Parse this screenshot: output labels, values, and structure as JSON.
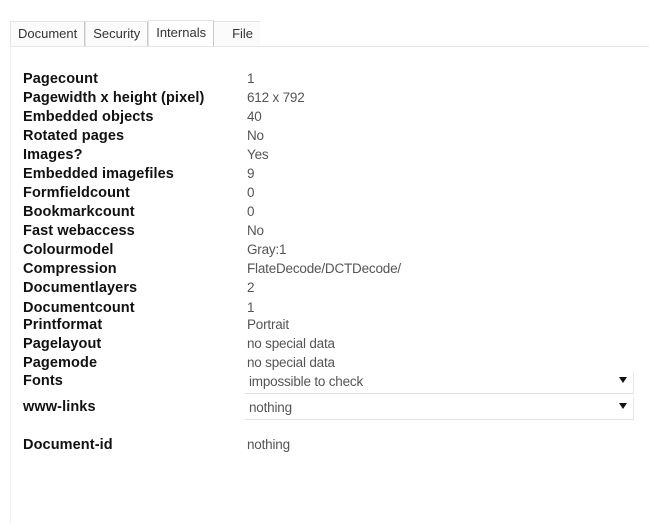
{
  "tabs": [
    {
      "label": "Document"
    },
    {
      "label": "Security"
    },
    {
      "label": "Internals"
    },
    {
      "label": "File"
    }
  ],
  "properties": [
    {
      "label": "Pagecount",
      "value": "1"
    },
    {
      "label": "Pagewidth x height (pixel)",
      "value": "612 x 792"
    },
    {
      "label": "Embedded objects",
      "value": "40"
    },
    {
      "label": "Rotated pages",
      "value": "No"
    },
    {
      "label": "Images?",
      "value": "Yes"
    },
    {
      "label": "Embedded imagefiles",
      "value": "9"
    },
    {
      "label": "Formfieldcount",
      "value": "0"
    },
    {
      "label": "Bookmarkcount",
      "value": "0"
    },
    {
      "label": "Fast webaccess",
      "value": "No"
    },
    {
      "label": "Colourmodel",
      "value": "Gray:1"
    },
    {
      "label": "Compression",
      "value": "FlateDecode/DCTDecode/"
    },
    {
      "label": "Documentlayers",
      "value": "2"
    },
    {
      "label": "Documentcount",
      "value": "1"
    },
    {
      "label": "Printformat",
      "value": "Portrait"
    },
    {
      "label": "Pagelayout",
      "value": "no special data"
    },
    {
      "label": "Pagemode",
      "value": "no special data"
    }
  ],
  "fonts": {
    "label": "Fonts",
    "value": "impossible to check"
  },
  "links": {
    "label": "www-links",
    "value": "nothing"
  },
  "document_id": {
    "label": "Document-id",
    "value": "nothing"
  }
}
